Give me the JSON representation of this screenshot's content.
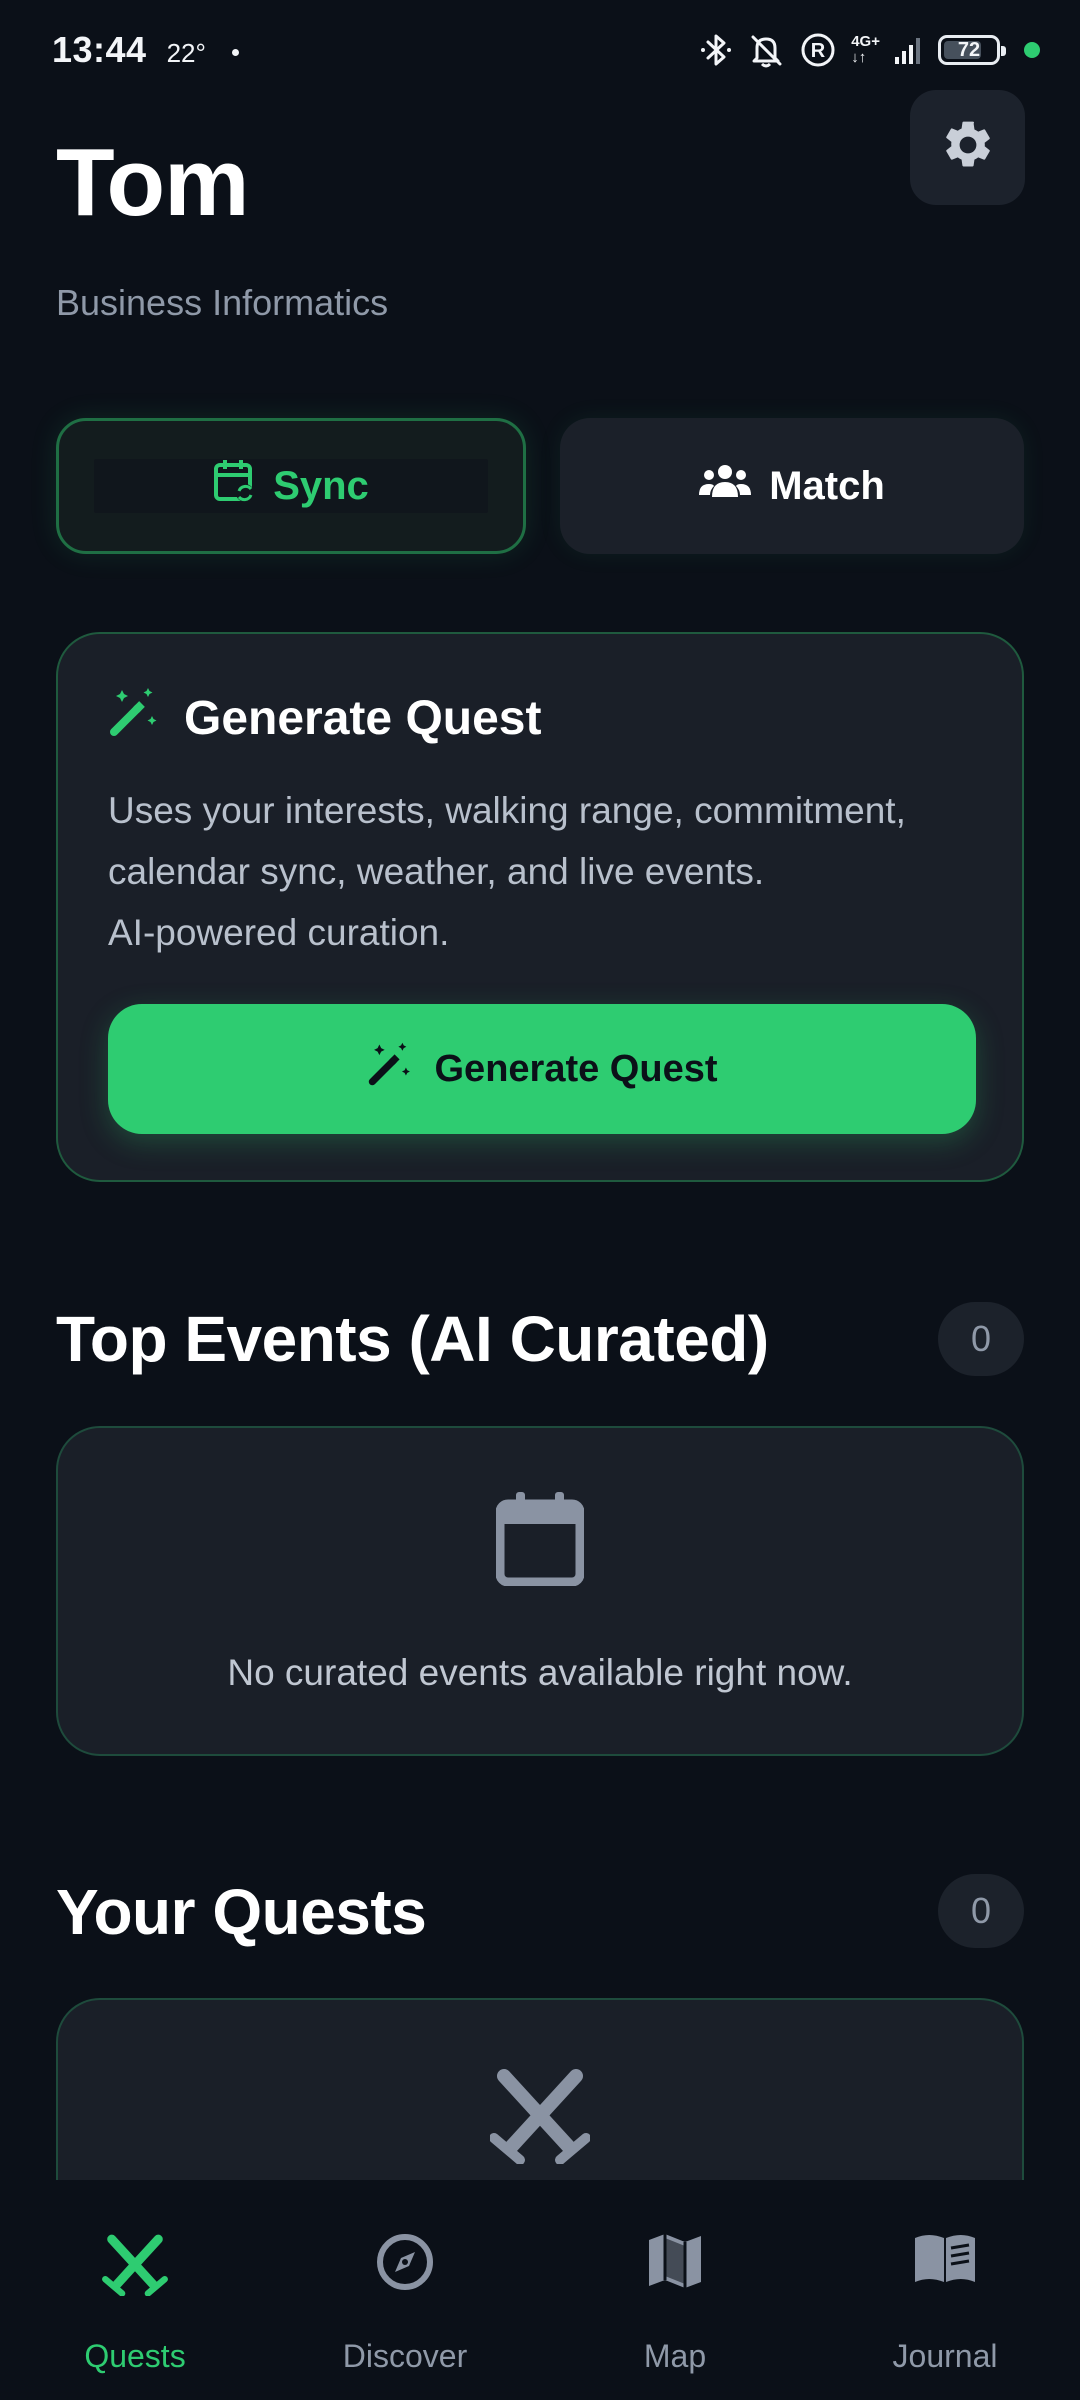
{
  "status_bar": {
    "time": "13:44",
    "temperature": "22°",
    "network_top": "4G+",
    "network_bottom": "↓↑",
    "battery": "72"
  },
  "profile": {
    "name": "Tom",
    "subtitle": "Business Informatics"
  },
  "actions": {
    "sync_label": "Sync",
    "match_label": "Match"
  },
  "generate_card": {
    "title": "Generate Quest",
    "description_lines": [
      "Uses your interests, walking range, commitment,",
      "calendar sync, weather, and live events.",
      "AI-powered curation."
    ],
    "button_label": "Generate Quest"
  },
  "top_events": {
    "title": "Top Events (AI Curated)",
    "count": "0",
    "empty_text": "No curated events available right now."
  },
  "your_quests": {
    "title": "Your Quests",
    "count": "0"
  },
  "bottom_nav": {
    "items": [
      {
        "label": "Quests",
        "icon": "crossed-swords-icon",
        "active": true
      },
      {
        "label": "Discover",
        "icon": "compass-icon",
        "active": false
      },
      {
        "label": "Map",
        "icon": "map-icon",
        "active": false
      },
      {
        "label": "Journal",
        "icon": "book-icon",
        "active": false
      }
    ]
  },
  "colors": {
    "background": "#0b1018",
    "card": "#1a1f28",
    "accent": "#2ecc71",
    "muted_text": "#8f99a8"
  }
}
